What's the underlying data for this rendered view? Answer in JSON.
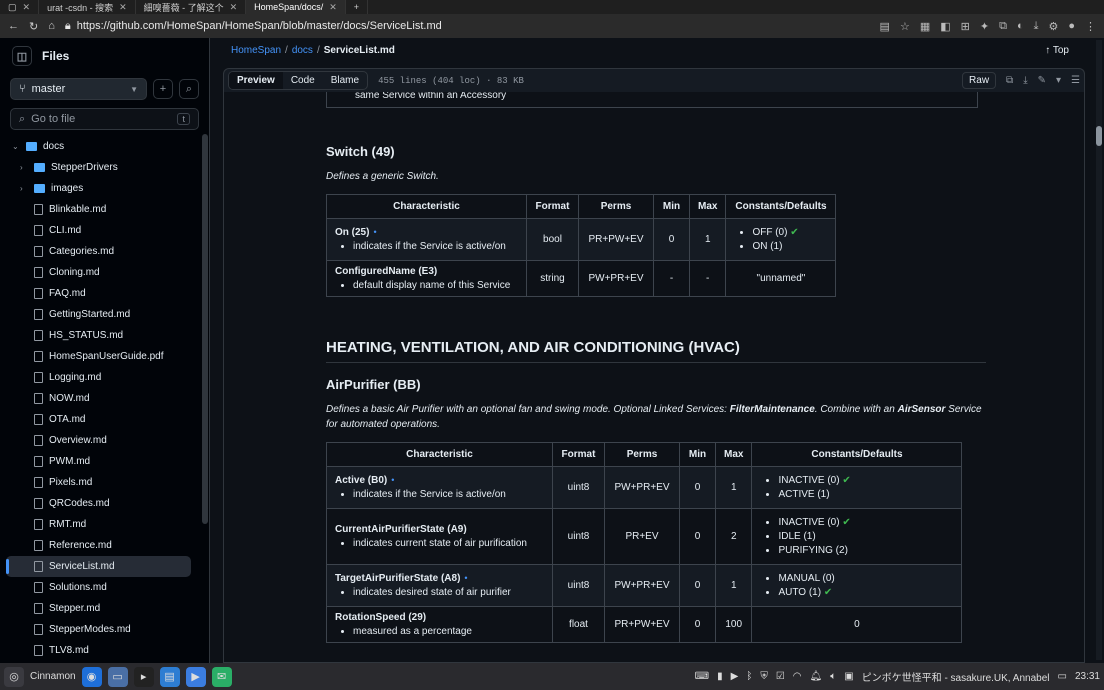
{
  "browser": {
    "tabs": [
      {
        "label": "",
        "active": false
      },
      {
        "label": "urat -csdn - 搜索",
        "active": false
      },
      {
        "label": "細嗅薔薇 - 了解这个",
        "active": false
      },
      {
        "label": "HomeSpan/docs/",
        "active": true
      }
    ],
    "new_tab": "+",
    "url": "https://github.com/HomeSpan/HomeSpan/blob/master/docs/ServiceList.md"
  },
  "sidebar": {
    "title": "Files",
    "branch": "master",
    "goto_placeholder": "Go to file",
    "goto_kbd": "t",
    "root_folder": "docs",
    "folders": [
      "StepperDrivers",
      "images"
    ],
    "files": [
      "Blinkable.md",
      "CLI.md",
      "Categories.md",
      "Cloning.md",
      "FAQ.md",
      "GettingStarted.md",
      "HS_STATUS.md",
      "HomeSpanUserGuide.pdf",
      "Logging.md",
      "NOW.md",
      "OTA.md",
      "Overview.md",
      "PWM.md",
      "Pixels.md",
      "QRCodes.md",
      "RMT.md",
      "Reference.md",
      "ServiceList.md",
      "Solutions.md",
      "Stepper.md",
      "StepperModes.md",
      "TLV8.md"
    ],
    "selected": "ServiceList.md"
  },
  "breadcrumb": {
    "repo": "HomeSpan",
    "sep1": "/",
    "dir": "docs",
    "sep2": "/",
    "file": "ServiceList.md",
    "top": "Top"
  },
  "file_header": {
    "preview": "Preview",
    "code": "Code",
    "blame": "Blame",
    "info": "455 lines (404 loc) · 83 KB",
    "raw": "Raw"
  },
  "doc": {
    "prev_text": "same Service within an Accessory",
    "switch_title": "Switch (49)",
    "switch_desc": "Defines a generic Switch.",
    "headers": [
      "Characteristic",
      "Format",
      "Perms",
      "Min",
      "Max",
      "Constants/Defaults"
    ],
    "switch_rows": [
      {
        "name": "On (25)",
        "desc": "indicates if the Service is active/on",
        "format": "bool",
        "perms": "PR+PW+EV",
        "min": "0",
        "max": "1",
        "consts": [
          "OFF (0) ✔",
          "ON (1)"
        ]
      },
      {
        "name": "ConfiguredName (E3)",
        "desc": "default display name of this Service",
        "format": "string",
        "perms": "PW+PR+EV",
        "min": "-",
        "max": "-",
        "const_text": "\"unnamed\""
      }
    ],
    "hvac_title": "HEATING, VENTILATION, AND AIR CONDITIONING (HVAC)",
    "air_title": "AirPurifier (BB)",
    "air_desc_1": "Defines a basic Air Purifier with an optional fan and swing mode. Optional Linked Services: ",
    "air_desc_b1": "FilterMaintenance",
    "air_desc_2": ". Combine with an ",
    "air_desc_b2": "AirSensor",
    "air_desc_3": " Service for automated operations.",
    "air_rows": [
      {
        "name": "Active (B0)",
        "dot": true,
        "desc": "indicates if the Service is active/on",
        "format": "uint8",
        "perms": "PW+PR+EV",
        "min": "0",
        "max": "1",
        "consts": [
          "INACTIVE (0) ✔",
          "ACTIVE (1)"
        ]
      },
      {
        "name": "CurrentAirPurifierState (A9)",
        "dot": false,
        "desc": "indicates current state of air purification",
        "format": "uint8",
        "perms": "PR+EV",
        "min": "0",
        "max": "2",
        "consts": [
          "INACTIVE (0) ✔",
          "IDLE (1)",
          "PURIFYING (2)"
        ]
      },
      {
        "name": "TargetAirPurifierState (A8)",
        "dot": true,
        "desc": "indicates desired state of air purifier",
        "format": "uint8",
        "perms": "PW+PR+EV",
        "min": "0",
        "max": "1",
        "consts": [
          "MANUAL (0)",
          "AUTO (1) ✔"
        ]
      },
      {
        "name": "RotationSpeed (29)",
        "dot": false,
        "desc": "measured as a percentage",
        "format": "float",
        "perms": "PR+PW+EV",
        "min": "0",
        "max": "100",
        "const_text": "0"
      }
    ]
  },
  "taskbar": {
    "start": "Cinnamon",
    "status": "ピンボケ世怪平和 - sasakure.UK, Annabel",
    "clock": "23:31"
  }
}
